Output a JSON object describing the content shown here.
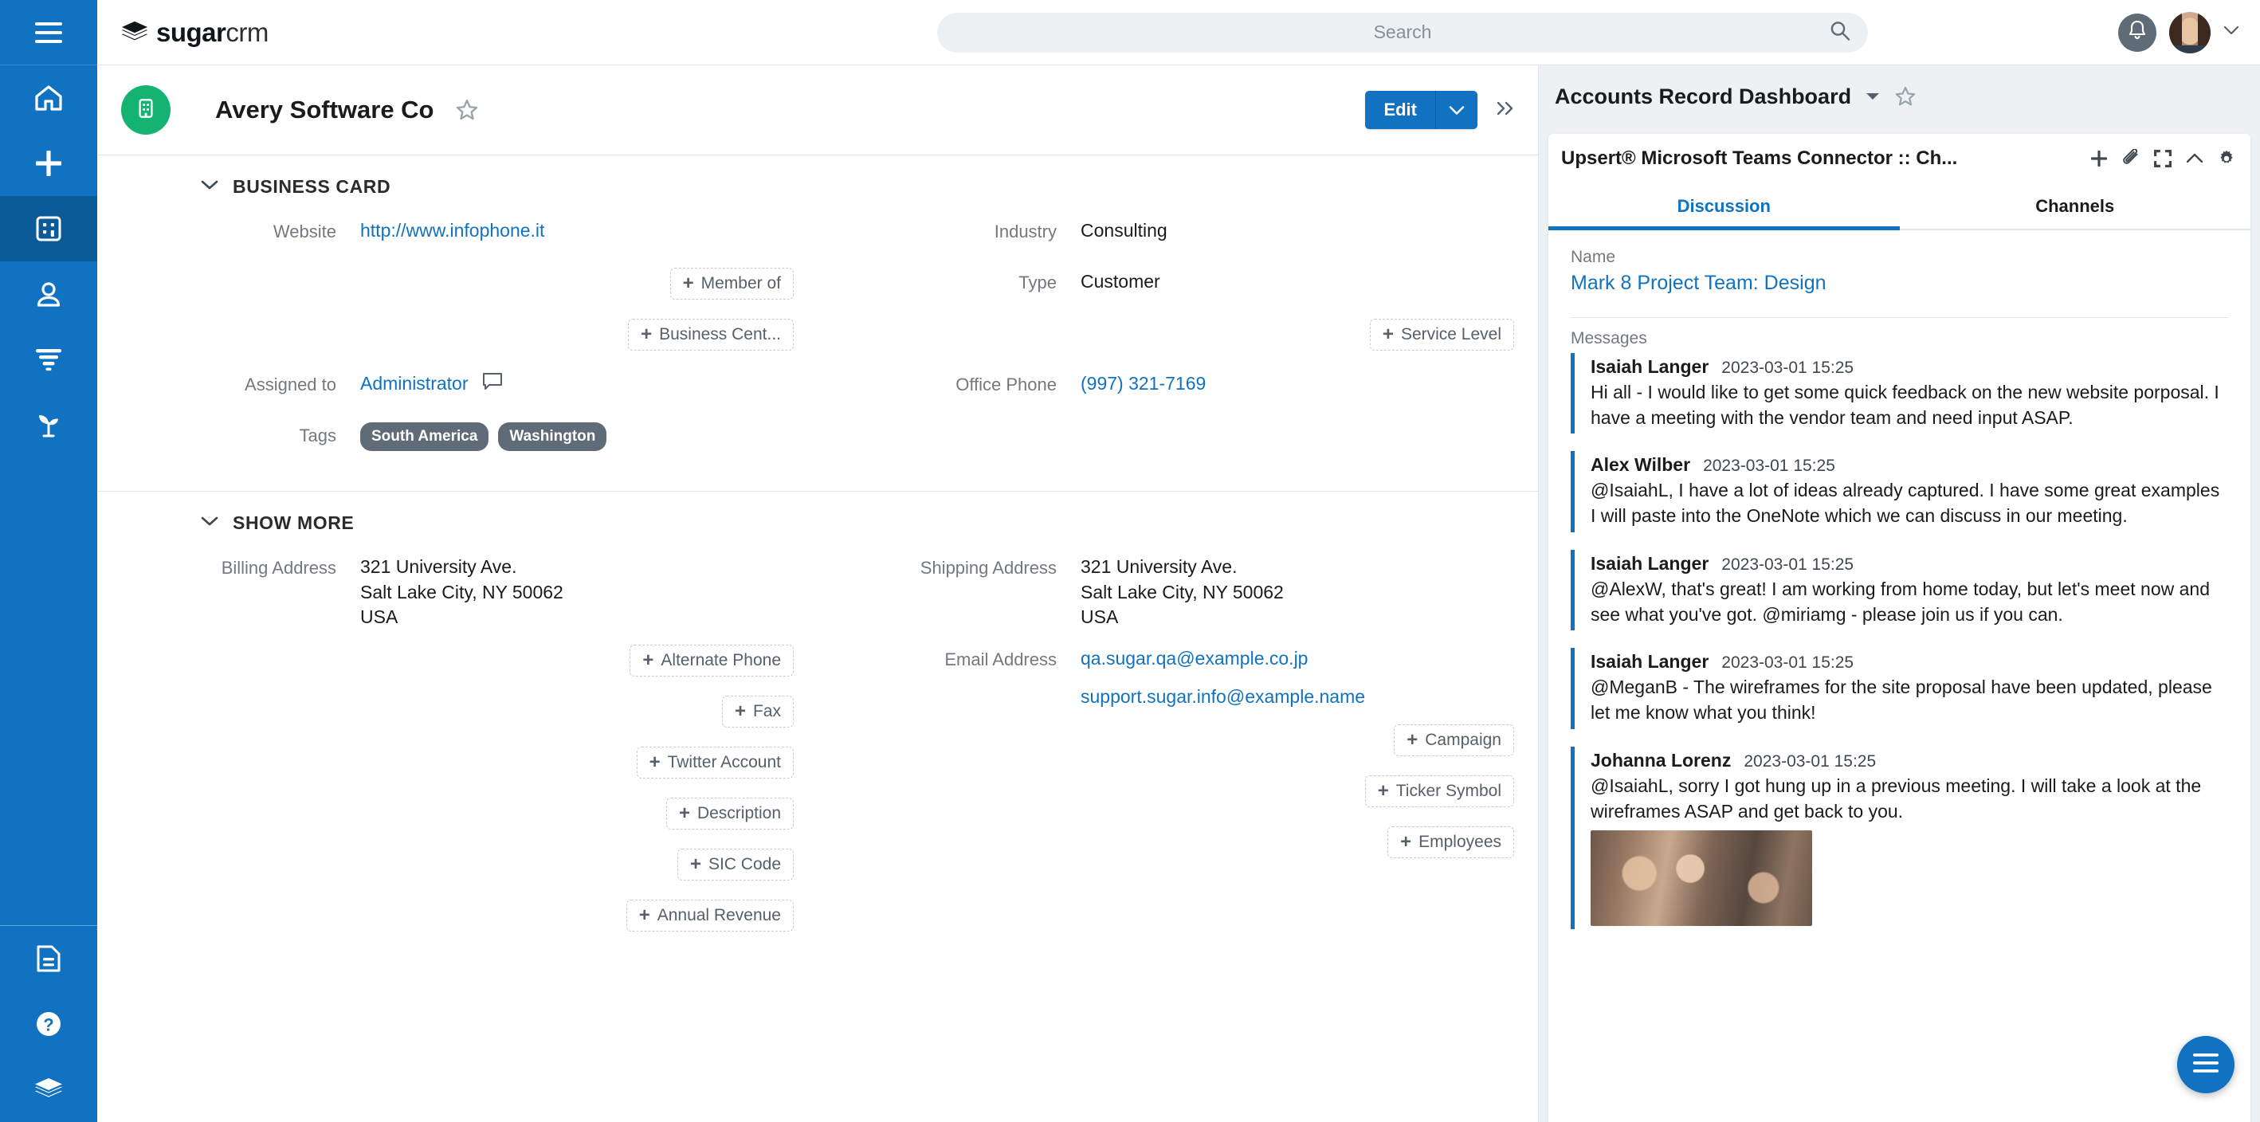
{
  "app": {
    "brand_bold": "sugar",
    "brand_light": "crm"
  },
  "sidebar": {
    "items": [
      {
        "name": "menu",
        "icon": "hamburger-icon",
        "active": false
      },
      {
        "name": "home",
        "icon": "home-icon",
        "active": false
      },
      {
        "name": "create",
        "icon": "plus-icon",
        "active": false
      },
      {
        "name": "accounts",
        "icon": "building-icon",
        "active": true
      },
      {
        "name": "contacts",
        "icon": "person-icon",
        "active": false
      },
      {
        "name": "leads",
        "icon": "funnel-icon",
        "active": false
      },
      {
        "name": "opportunities",
        "icon": "sprout-icon",
        "active": false
      }
    ],
    "bottom_items": [
      {
        "name": "documents",
        "icon": "document-icon"
      },
      {
        "name": "help",
        "icon": "question-circle-icon"
      },
      {
        "name": "more",
        "icon": "layers-icon"
      }
    ]
  },
  "search": {
    "placeholder": "Search",
    "value": ""
  },
  "record": {
    "title": "Avery Software Co",
    "avatar_icon": "building-icon",
    "favorite": false,
    "edit_label": "Edit",
    "more_actions_icon": "double-chevron-right-icon"
  },
  "business_card": {
    "heading": "BUSINESS CARD",
    "left_fields": [
      {
        "kind": "value",
        "label": "Website",
        "value": "http://www.infophone.it",
        "link": true
      },
      {
        "kind": "add",
        "label": "Member of"
      },
      {
        "kind": "add",
        "label": "Business Cent..."
      },
      {
        "kind": "value",
        "label": "Assigned to",
        "value": "Administrator",
        "link": true,
        "icon": "comment-icon"
      },
      {
        "kind": "tags",
        "label": "Tags",
        "tags": [
          "South America",
          "Washington"
        ]
      }
    ],
    "right_fields": [
      {
        "kind": "value",
        "label": "Industry",
        "value": "Consulting",
        "link": false
      },
      {
        "kind": "value",
        "label": "Type",
        "value": "Customer",
        "link": false
      },
      {
        "kind": "add",
        "label": "Service Level"
      },
      {
        "kind": "value",
        "label": "Office Phone",
        "value": "(997) 321-7169",
        "link": true
      }
    ]
  },
  "show_more": {
    "heading": "SHOW MORE",
    "left_fields": [
      {
        "kind": "value",
        "label": "Billing Address",
        "value": "321 University Ave.\nSalt Lake City, NY 50062\nUSA",
        "link": false
      },
      {
        "kind": "add",
        "label": "Alternate Phone"
      },
      {
        "kind": "add",
        "label": "Fax"
      },
      {
        "kind": "add",
        "label": "Twitter Account"
      },
      {
        "kind": "add",
        "label": "Description"
      },
      {
        "kind": "add",
        "label": "SIC Code"
      },
      {
        "kind": "add",
        "label": "Annual Revenue"
      }
    ],
    "right_fields": [
      {
        "kind": "value",
        "label": "Shipping Address",
        "value": "321 University Ave.\nSalt Lake City, NY 50062\nUSA",
        "link": false
      },
      {
        "kind": "emails",
        "label": "Email Address",
        "emails": [
          "qa.sugar.qa@example.co.jp",
          "support.sugar.info@example.name"
        ]
      },
      {
        "kind": "add",
        "label": "Campaign"
      },
      {
        "kind": "add",
        "label": "Ticker Symbol"
      },
      {
        "kind": "add",
        "label": "Employees"
      }
    ]
  },
  "dashboard": {
    "title": "Accounts Record Dashboard",
    "caret_icon": "chevron-down-icon",
    "star_icon": "star-outline-icon",
    "widget": {
      "title": "Upsert® Microsoft Teams Connector :: Ch...",
      "tools": [
        {
          "name": "add",
          "icon": "plus-icon"
        },
        {
          "name": "link",
          "icon": "paperclip-icon"
        },
        {
          "name": "collapse-expand",
          "icon": "contract-icon"
        },
        {
          "name": "collapse",
          "icon": "chevron-up-icon"
        },
        {
          "name": "settings",
          "icon": "gear-icon"
        }
      ],
      "tabs": [
        {
          "label": "Discussion",
          "active": true
        },
        {
          "label": "Channels",
          "active": false
        }
      ],
      "name_label": "Name",
      "name_value": "Mark 8 Project Team: Design",
      "messages_label": "Messages",
      "messages": [
        {
          "author": "Isaiah Langer",
          "time": "2023-03-01 15:25",
          "text": "Hi all - I would like to get some quick feedback on the new website porposal. I have a meeting with the vendor team and need input ASAP.",
          "has_image": false
        },
        {
          "author": "Alex Wilber",
          "time": "2023-03-01 15:25",
          "text": "@IsaiahL, I have a lot of ideas already captured. I have some great examples I will paste into the OneNote which we can discuss in our meeting.",
          "has_image": false
        },
        {
          "author": "Isaiah Langer",
          "time": "2023-03-01 15:25",
          "text": "@AlexW, that's great! I am working from home today, but let's meet now and see what you've got. @miriamg - please join us if you can.",
          "has_image": false
        },
        {
          "author": "Isaiah Langer",
          "time": "2023-03-01 15:25",
          "text": "@MeganB - The wireframes for the site proposal have been updated, please let me know what you think!",
          "has_image": false
        },
        {
          "author": "Johanna Lorenz",
          "time": "2023-03-01 15:25",
          "text": "@IsaiahL, sorry I got hung up in a previous meeting. I will take a look at the wireframes ASAP and get back to you.",
          "has_image": true
        }
      ]
    }
  },
  "fab": {
    "icon": "hamburger-icon"
  },
  "colors": {
    "brand_blue": "#1072c0",
    "rail_active": "#0b5b99",
    "accent_green": "#15b371",
    "tag_gray": "#5f6b76",
    "label_gray": "#73797f"
  }
}
